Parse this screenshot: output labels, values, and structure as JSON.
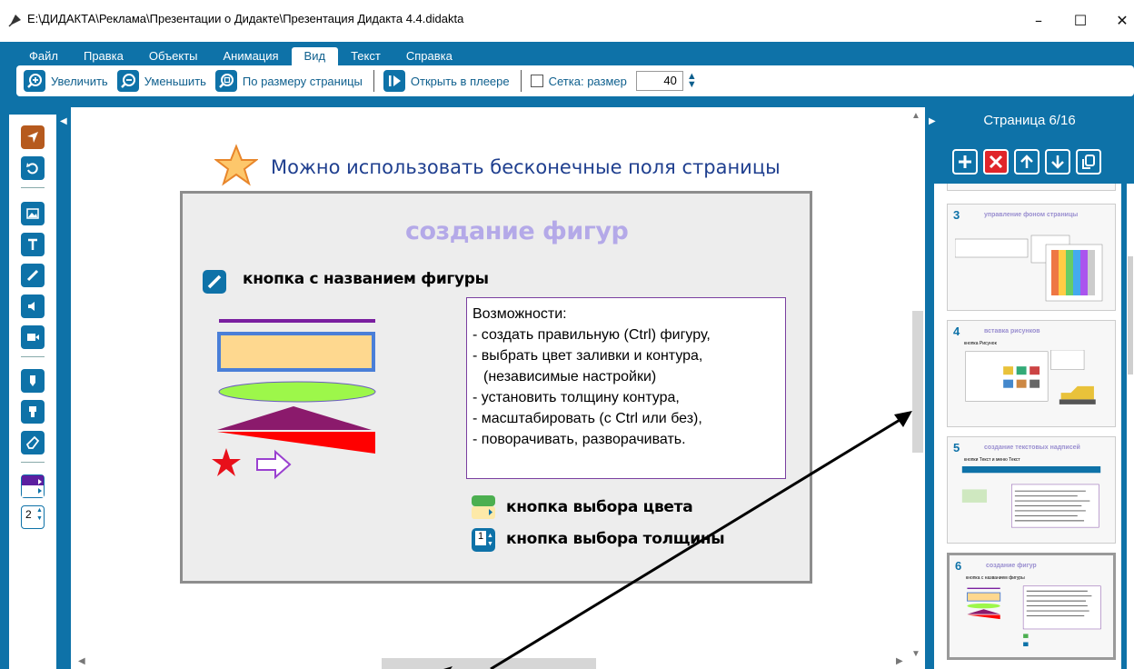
{
  "window": {
    "title": "E:\\ДИДАКТА\\Реклама\\Презентации о Дидакте\\Презентация Дидакта 4.4.didakta",
    "minimize": "–",
    "maximize": "☐",
    "close": "✕"
  },
  "menu": {
    "items": [
      "Файл",
      "Правка",
      "Объекты",
      "Анимация",
      "Вид",
      "Текст",
      "Справка"
    ],
    "active": "Вид"
  },
  "toolbar": {
    "zoom_in": "Увеличить",
    "zoom_out": "Уменьшить",
    "fit_page": "По размеру страницы",
    "open_player": "Открыть в плеере",
    "grid_label": "Сетка: размер",
    "grid_size": "40",
    "grid_checked": false
  },
  "tools": {
    "icons": [
      "pointer-icon",
      "undo-icon",
      "image-icon",
      "text-icon",
      "pen-icon",
      "sound-icon",
      "video-icon",
      "marker-icon",
      "highlighter-icon",
      "eraser-icon",
      "color-picker-icon",
      "line-width-icon"
    ],
    "line_width": "2",
    "selected": "pointer-icon"
  },
  "canvas": {
    "headline": "Можно использовать бесконечные поля страницы",
    "slide": {
      "title": "создание фигур",
      "shape_button_label": "кнопка с названием фигуры",
      "features": [
        "Возможности:",
        " - создать правильную (Ctrl) фигуру,",
        " - выбрать цвет заливки и контура,",
        "   (независимые настройки)",
        " - установить толщину контура,",
        " - масштабировать (с Ctrl или без),",
        " - поворачивать, разворачивать."
      ],
      "color_button_label": "кнопка выбора цвета",
      "width_button_label": "кнопка выбора толщины",
      "width_button_value": "1"
    }
  },
  "pages_panel": {
    "counter": "Страница 6/16",
    "buttons": [
      "add-page-icon",
      "delete-page-icon",
      "move-up-icon",
      "move-down-icon",
      "duplicate-page-icon"
    ],
    "thumbnails": [
      {
        "number": "3",
        "title": "управление фоном страницы"
      },
      {
        "number": "4",
        "title": "вставка рисунков",
        "subtitle": "кнопка Рисунок"
      },
      {
        "number": "5",
        "title": "создание текстовых надписей",
        "subtitle": "кнопки Текст и меню Текст"
      },
      {
        "number": "6",
        "title": "создание фигур",
        "subtitle": "кнопка с названием фигуры"
      }
    ],
    "current_page": "6"
  },
  "colors": {
    "accent": "#0e72a8",
    "selected_tool": "#b65a1e",
    "delete": "#e0252a",
    "title_purple": "#b4a9e8"
  }
}
